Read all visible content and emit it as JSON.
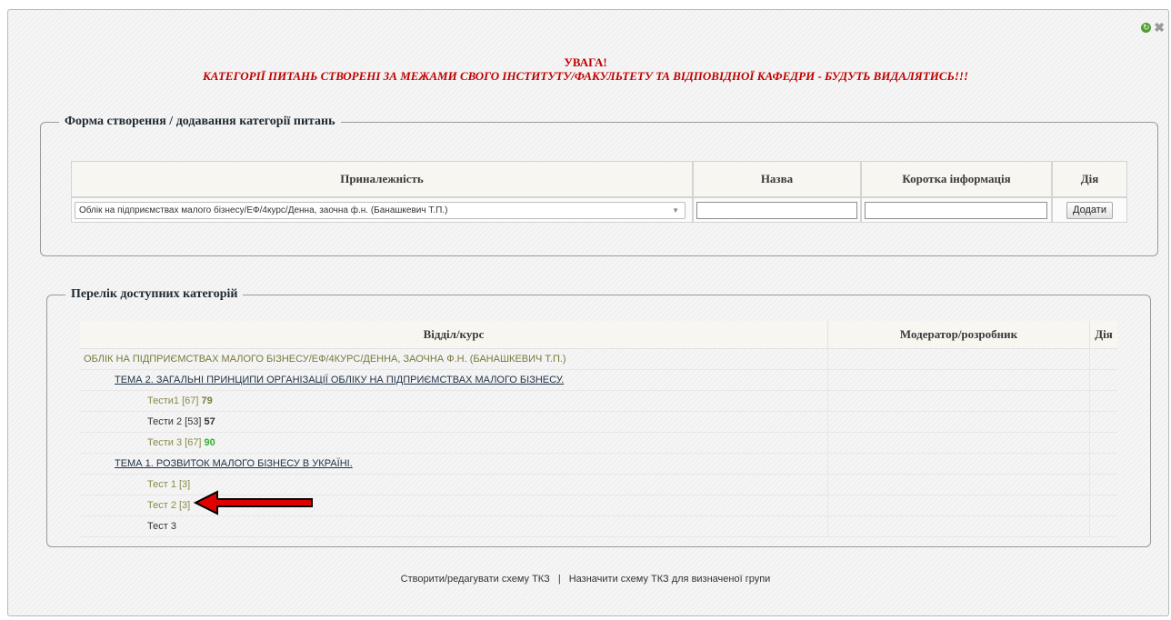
{
  "warning": {
    "title": "УВАГА!",
    "text": "КАТЕГОРІЇ ПИТАНЬ СТВОРЕНІ ЗА МЕЖАМИ СВОГО ІНСТИТУТУ/ФАКУЛЬТЕТУ ТА ВІДПОВІДНОЇ КАФЕДРИ - БУДУТЬ ВИДАЛЯТИСЬ!!!"
  },
  "form": {
    "legend": "Форма створення / додавання категорії питань",
    "headers": {
      "belonging": "Приналежність",
      "name": "Назва",
      "short_info": "Коротка інформація",
      "action": "Дія"
    },
    "select_value": "Облік на підприємствах малого бізнесу/ЕФ/4курс/Денна, заочна ф.н. (Банашкевич Т.П.)",
    "name_value": "",
    "short_info_value": "",
    "add_button": "Додати"
  },
  "list": {
    "legend": "Перелік доступних категорій",
    "headers": {
      "division": "Відділ/курс",
      "moderator": "Модератор/розробник",
      "action": "Дія"
    },
    "course": "ОБЛІК НА ПІДПРИЄМСТВАХ МАЛОГО БІЗНЕСУ/ЕФ/4КУРС/ДЕННА, ЗАОЧНА Ф.Н. (БАНАШКЕВИЧ Т.П.)",
    "topic2": "ТЕМА 2. ЗАГАЛЬНІ ПРИНЦИПИ ОРГАНІЗАЦІЇ ОБЛІКУ НА ПІДПРИЄМСТВАХ МАЛОГО БІЗНЕСУ.",
    "tests2": [
      {
        "label": "Тести1 [67]",
        "count": "79"
      },
      {
        "label": "Тести 2 [53]",
        "count": "57"
      },
      {
        "label": "Тести 3 [67]",
        "count": "90"
      }
    ],
    "topic1": "ТЕМА 1. РОЗВИТОК МАЛОГО БІЗНЕСУ В УКРАЇНІ.",
    "tests1": [
      {
        "label": "Тест 1 [3]"
      },
      {
        "label": "Тест 2 [3]"
      },
      {
        "label": "Тест 3"
      }
    ]
  },
  "footer": {
    "link1": "Створити/редагувати схему ТКЗ",
    "separator": "|",
    "link2": "Назначити схему ТКЗ для визначеної групи"
  },
  "colors": {
    "warning": "#c00000",
    "olive": "#7a7a3c",
    "green_count": "#36b02f",
    "arrow": "#e00000"
  }
}
